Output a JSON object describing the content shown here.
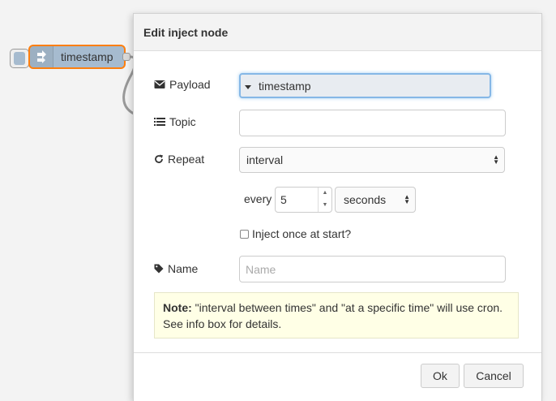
{
  "node": {
    "label": "timestamp"
  },
  "dialog": {
    "title": "Edit inject node",
    "payload": {
      "label": "Payload",
      "type_value": "timestamp",
      "type_icon": "dropdown-caret-icon",
      "icon": "envelope-icon"
    },
    "topic": {
      "label": "Topic",
      "value": "",
      "icon": "list-icon"
    },
    "repeat": {
      "label": "Repeat",
      "value": "interval",
      "icon": "refresh-icon",
      "every_label": "every",
      "every_value": "5",
      "unit_value": "seconds"
    },
    "once": {
      "label": "Inject once at start?",
      "checked": false
    },
    "name": {
      "label": "Name",
      "placeholder": "Name",
      "icon": "tag-icon"
    },
    "note": {
      "bold": "Note:",
      "line1": "\"interval between times\" and \"at a specific time\" will use cron.",
      "line2": "See info box for details."
    },
    "buttons": {
      "ok": "Ok",
      "cancel": "Cancel"
    }
  },
  "colors": {
    "node_fill": "#a6bbcf",
    "selection": "#ff7f0e",
    "note_bg": "#ffffe6",
    "focus": "#85b7e6"
  }
}
